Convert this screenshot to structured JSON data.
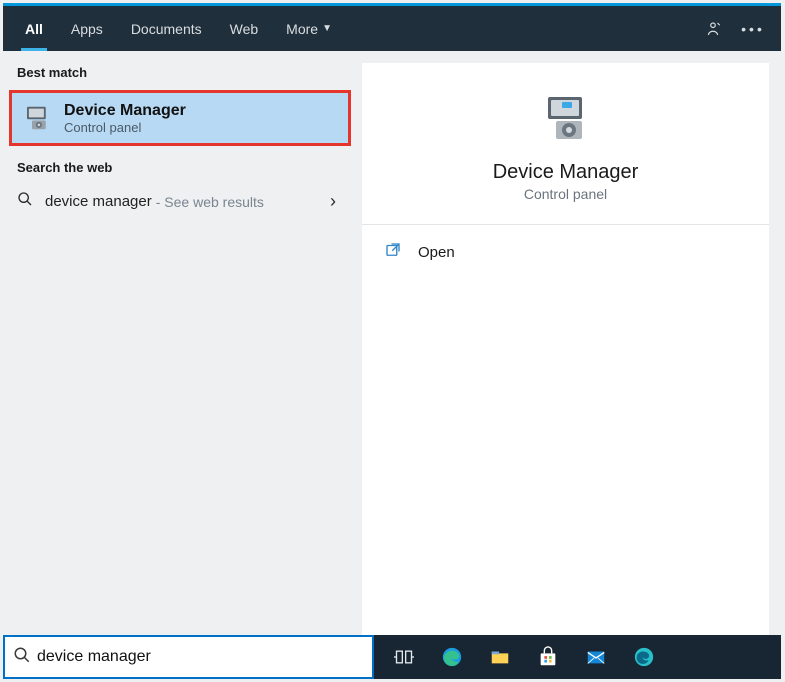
{
  "tabs": {
    "all": "All",
    "apps": "Apps",
    "documents": "Documents",
    "web": "Web",
    "more": "More"
  },
  "left": {
    "best_match_header": "Best match",
    "best_match": {
      "title": "Device Manager",
      "subtitle": "Control panel"
    },
    "search_web_header": "Search the web",
    "web_item": {
      "term": "device manager",
      "hint": "- See web results"
    }
  },
  "detail": {
    "title": "Device Manager",
    "subtitle": "Control panel",
    "open_label": "Open"
  },
  "search": {
    "value": "device manager"
  }
}
